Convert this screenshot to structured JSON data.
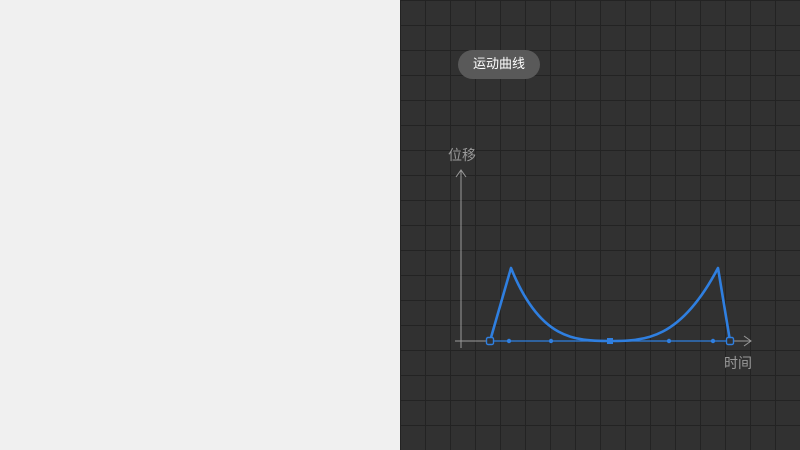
{
  "curve_editor": {
    "title_button": "运动曲线",
    "y_axis_label": "位移",
    "x_axis_label": "时间"
  },
  "colors": {
    "left_background": "#f0f0f0",
    "editor_background": "#313131",
    "grid_line": "#232323",
    "curve": "#2f7fe0",
    "axis": "#9a9a9a"
  }
}
